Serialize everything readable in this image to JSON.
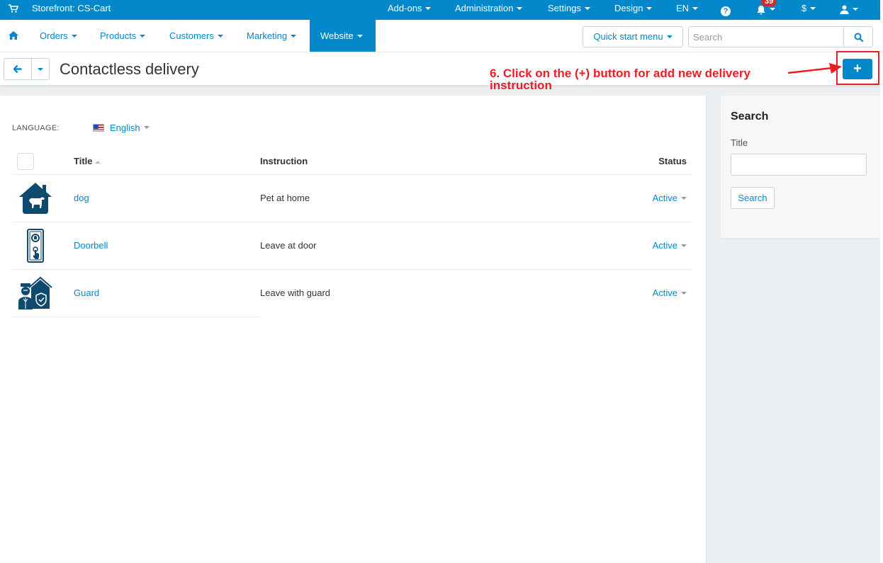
{
  "topbar": {
    "storefront_label": "Storefront: CS-Cart",
    "menus": [
      {
        "label": "Add-ons"
      },
      {
        "label": "Administration"
      },
      {
        "label": "Settings"
      },
      {
        "label": "Design"
      },
      {
        "label": "EN"
      }
    ],
    "notifications_count": "39",
    "currency": "$",
    "icons": {
      "cart": "shopping-cart-icon",
      "help": "question-circle-icon",
      "bell": "bell-icon",
      "user": "user-icon"
    }
  },
  "navbar": {
    "items": [
      {
        "label": "Orders"
      },
      {
        "label": "Products"
      },
      {
        "label": "Customers"
      },
      {
        "label": "Marketing"
      },
      {
        "label": "Website",
        "active": true
      }
    ],
    "quick_start_label": "Quick start menu",
    "search_placeholder": "Search",
    "search_value": ""
  },
  "page": {
    "title": "Contactless delivery",
    "add_button_label": "+"
  },
  "annotation": {
    "text": "6. Click on the (+) button for add new delivery instruction",
    "color": "#ee1c25"
  },
  "language": {
    "label": "LANGUAGE:",
    "selected": "English"
  },
  "table": {
    "columns": {
      "title": "Title",
      "instruction": "Instruction",
      "status": "Status"
    },
    "rows": [
      {
        "icon": "dog-house-icon",
        "title": "dog",
        "instruction": "Pet at home",
        "status": "Active"
      },
      {
        "icon": "doorbell-icon",
        "title": "Doorbell",
        "instruction": "Leave at door",
        "status": "Active"
      },
      {
        "icon": "guard-house-icon",
        "title": "Guard",
        "instruction": "Leave with guard",
        "status": "Active"
      }
    ]
  },
  "sidebar": {
    "heading": "Search",
    "title_label": "Title",
    "title_value": "",
    "search_button": "Search"
  },
  "colors": {
    "primary": "#0388cc",
    "icon_dark": "#0d4a6e",
    "badge": "#c9302c",
    "annotation": "#ee1c25"
  }
}
